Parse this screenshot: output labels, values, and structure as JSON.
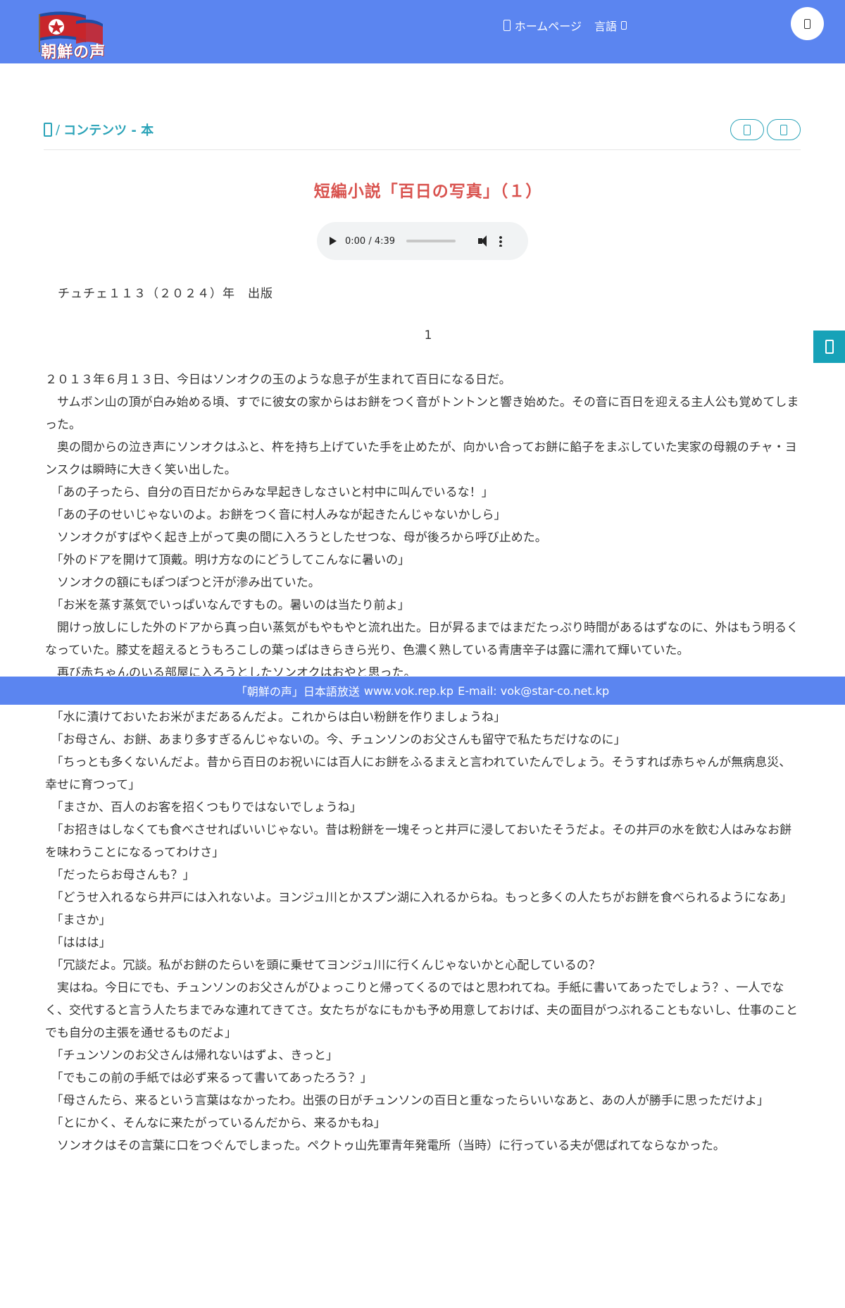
{
  "header": {
    "logo_text": "朝鮮の声",
    "nav": {
      "home_label": "ホームページ",
      "language_label": "言語"
    }
  },
  "breadcrumb": {
    "separator": "/",
    "section": "コンテンツ - 本"
  },
  "article": {
    "title": "短編小説「百日の写真」（１）",
    "audio": {
      "time": "0:00 / 4:39"
    },
    "publication": "チュチェ１１３（２０２４）年　出版",
    "chapter": "1",
    "paragraphs_upper": [
      "２０１３年６月１３日、今日はソンオクの玉のような息子が生まれて百日になる日だ。",
      "　サムボン山の頂が白み始める頃、すでに彼女の家からはお餅をつく音がトントンと響き始めた。その音に百日を迎える主人公も覚めてしまった。",
      "　奥の間からの泣き声にソンオクはふと、杵を持ち上げていた手を止めたが、向かい合ってお餅に餡子をまぶしていた実家の母親のチャ・ヨンスクは瞬時に大きく笑い出した。",
      "　「あの子ったら、自分の百日だからみな早起きしなさいと村中に叫んでいるな！」",
      "　「あの子のせいじゃないのよ。お餅をつく音に村人みなが起きたんじゃないかしら」",
      "　ソンオクがすばやく起き上がって奥の間に入ろうとしたせつな、母が後ろから呼び止めた。",
      "　「外のドアを開けて頂戴。明け方なのにどうしてこんなに暑いの」",
      "　ソンオクの額にもぽつぽつと汗が滲み出ていた。",
      "　「お米を蒸す蒸気でいっぱいなんですもの。暑いのは当たり前よ」",
      "　開けっ放しにした外のドアから真っ白い蒸気がもやもやと流れ出た。日が昇るまではまだたっぷり時間があるはずなのに、外はもう明るくなっていた。膝丈を超えるとうもろこしの葉っぱはきらきら光り、色濃く熟している青唐辛子は露に濡れて輝いていた。",
      "　再び赤ちゃんのいる部屋に入ろうとしたソンオクはおやと思った。"
    ],
    "paragraphs_lower": [
      "　「水に漬けておいたお米がまだあるんだよ。これからは白い粉餅を作りましょうね」",
      "　「お母さん、お餅、あまり多すぎるんじゃないの。今、チュンソンのお父さんも留守で私たちだけなのに」",
      "　「ちっとも多くないんだよ。昔から百日のお祝いには百人にお餅をふるまえと言われていたんでしょう。そうすれば赤ちゃんが無病息災、幸せに育つって」",
      "　「まさか、百人のお客を招くつもりではないでしょうね」",
      "　「お招きはしなくても食べさせればいいじゃない。昔は粉餅を一塊そっと井戸に浸しておいたそうだよ。その井戸の水を飲む人はみなお餅を味わうことになるってわけさ」",
      "　「だったらお母さんも？」",
      "　「どうせ入れるなら井戸には入れないよ。ヨンジュ川とかスプン湖に入れるからね。もっと多くの人たちがお餅を食べられるようになあ」",
      "　「まさか」",
      "　「ははは」",
      "　「冗談だよ。冗談。私がお餅のたらいを頭に乗せてヨンジュ川に行くんじゃないかと心配しているの？",
      "　実はね。今日にでも、チュンソンのお父さんがひょっこりと帰ってくるのではと思われてね。手紙に書いてあったでしょう？、一人でなく、交代すると言う人たちまでみな連れてきてさ。女たちがなにもかも予め用意しておけば、夫の面目がつぶれることもないし、仕事のことでも自分の主張を通せるものだよ」",
      "　「チュンソンのお父さんは帰れないはずよ、きっと」",
      "　「でもこの前の手紙では必ず来るって書いてあったろう？」",
      "　「母さんたら、来るという言葉はなかったわ。出張の日がチュンソンの百日と重なったらいいなあと、あの人が勝手に思っただけよ」",
      "　「とにかく、そんなに来たがっているんだから、来るかもね」",
      "　ソンオクはその言葉に口をつぐんでしまった。ペクトゥ山先軍青年発電所（当時）に行っている夫が偲ばれてならなかった。"
    ]
  },
  "footer": {
    "broadcast": "「朝鮮の声」日本語放送",
    "site": "www.vok.rep.kp",
    "email": "E-mail: vok@star-co.net.kp"
  },
  "colors": {
    "header_bg": "#5b85f0",
    "accent": "#2aa3b8",
    "title": "#d9534f"
  }
}
